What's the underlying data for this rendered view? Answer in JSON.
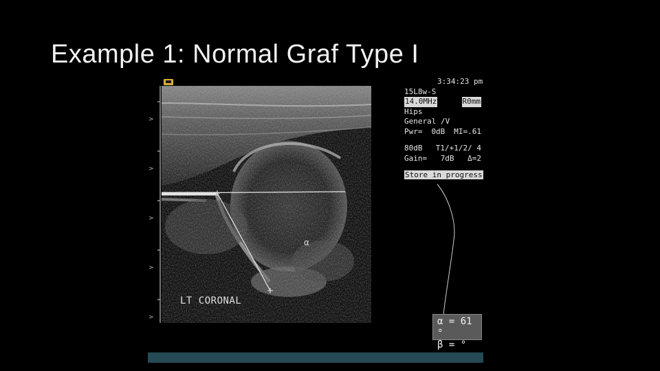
{
  "slide": {
    "title": "Example 1: Normal Graf Type I"
  },
  "ultrasound": {
    "readout": {
      "time": "3:34:23 pm",
      "probe": "15L8w-S",
      "frequency": "14.0MHz",
      "depth": "R0mm",
      "preset": "Hips",
      "mode": "General /V",
      "pwr_label": "Pwr=",
      "pwr_value": "0dB",
      "mi": "MI=.61",
      "dynamic_range": "80dB",
      "t_settings": "T1/+1/2/ 4",
      "gain_label": "Gain=",
      "gain_value": "7dB",
      "delta": "Δ=2",
      "status": "Store in progress"
    },
    "view_label": "LT CORONAL",
    "alpha_marker": "α",
    "angles": {
      "alpha": "α = 61 °",
      "beta": "β =  °"
    }
  },
  "colors": {
    "background": "#000000",
    "angle_box": "#5a5a5a",
    "bottom_bar": "#264a55",
    "probe_icon": "#d8b030"
  },
  "icons": [
    "probe-icon"
  ]
}
